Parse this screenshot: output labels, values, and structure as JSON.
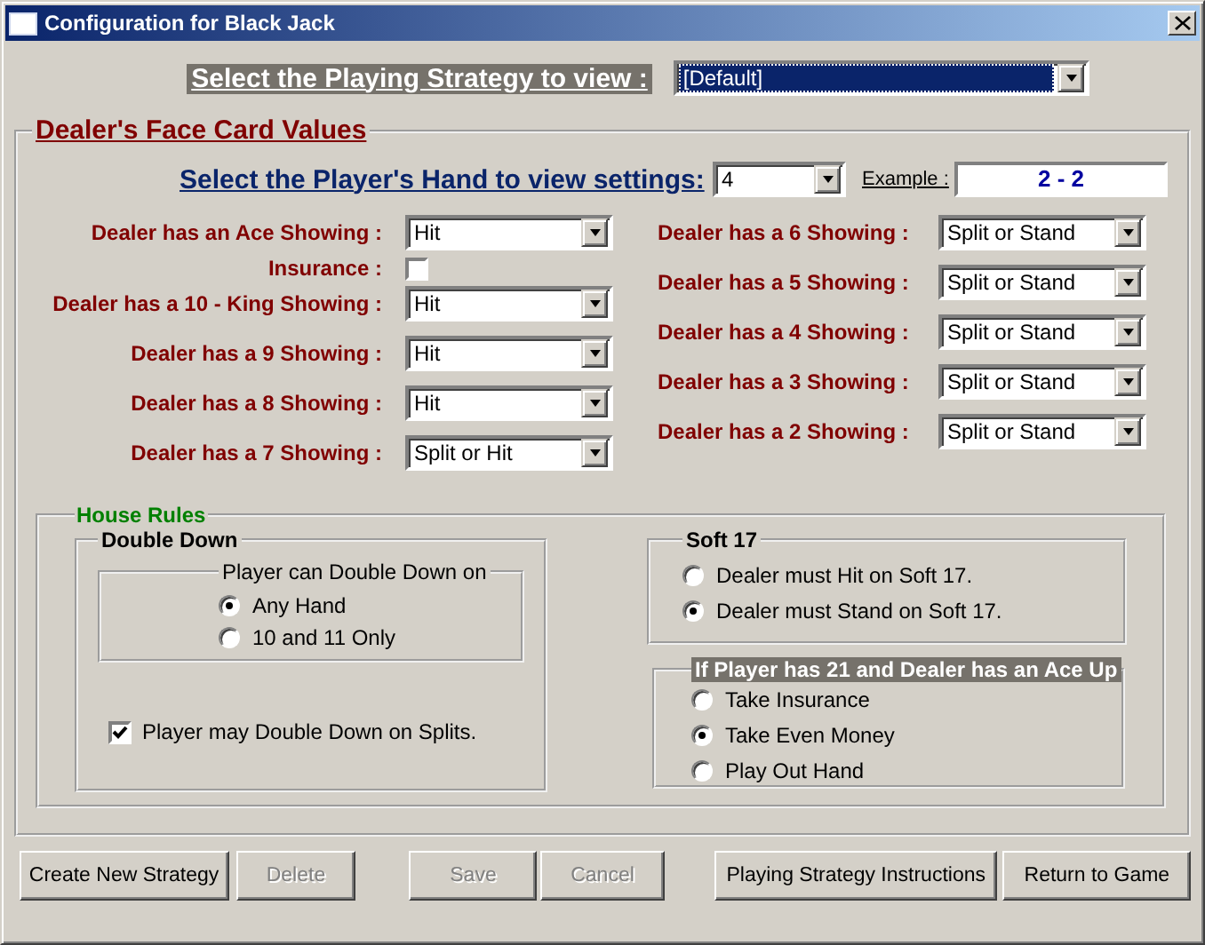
{
  "window": {
    "title": "Configuration for Black Jack"
  },
  "strategy": {
    "label": "Select the Playing Strategy to view :",
    "value": "[Default]",
    "highlighted": true
  },
  "face_card_values": {
    "title": "Dealer's Face Card Values",
    "hand": {
      "label": "Select the Player's Hand to view settings:",
      "value": "4"
    },
    "example": {
      "label": "Example :",
      "value": "2 - 2"
    },
    "left_rows": [
      {
        "kind": "select",
        "label": "Dealer has an Ace Showing :",
        "value": "Hit"
      },
      {
        "kind": "checkbox",
        "label": "Insurance :",
        "checked": false
      },
      {
        "kind": "select",
        "label": "Dealer has a 10 - King Showing :",
        "value": "Hit"
      },
      {
        "kind": "select",
        "label": "Dealer has a 9 Showing :",
        "value": "Hit"
      },
      {
        "kind": "select",
        "label": "Dealer has a 8 Showing :",
        "value": "Hit"
      },
      {
        "kind": "select",
        "label": "Dealer has a 7 Showing :",
        "value": "Split or Hit"
      }
    ],
    "right_rows": [
      {
        "kind": "select",
        "label": "Dealer has a 6 Showing :",
        "value": "Split or Stand"
      },
      {
        "kind": "select",
        "label": "Dealer has a 5 Showing :",
        "value": "Split or Stand"
      },
      {
        "kind": "select",
        "label": "Dealer has a 4 Showing :",
        "value": "Split or Stand"
      },
      {
        "kind": "select",
        "label": "Dealer has a 3 Showing :",
        "value": "Split or Stand"
      },
      {
        "kind": "select",
        "label": "Dealer has a 2 Showing :",
        "value": "Split or Stand"
      }
    ]
  },
  "house_rules": {
    "title": "House Rules",
    "double_down": {
      "title": "Double Down",
      "group_title": "Player can Double Down on",
      "options": [
        {
          "label": "Any Hand",
          "selected": true
        },
        {
          "label": "10 and 11 Only",
          "selected": false
        }
      ],
      "splits": {
        "label": "Player may Double Down on Splits.",
        "checked": true
      }
    },
    "soft17": {
      "title": "Soft 17",
      "options": [
        {
          "label": "Dealer must Hit on Soft 17.",
          "selected": false
        },
        {
          "label": "Dealer must Stand on Soft 17.",
          "selected": true
        }
      ]
    },
    "ace_up": {
      "title": "If Player has 21 and Dealer has an Ace Up",
      "options": [
        {
          "label": "Take Insurance",
          "selected": false
        },
        {
          "label": "Take Even Money",
          "selected": true
        },
        {
          "label": "Play Out Hand",
          "selected": false
        }
      ]
    }
  },
  "buttons": [
    {
      "label": "Create New Strategy",
      "disabled": false
    },
    {
      "label": "Delete",
      "disabled": true
    },
    {
      "label": "Save",
      "disabled": true
    },
    {
      "label": "Cancel",
      "disabled": true
    },
    {
      "label": "Playing Strategy Instructions",
      "disabled": false
    },
    {
      "label": "Return to Game",
      "disabled": false
    }
  ]
}
